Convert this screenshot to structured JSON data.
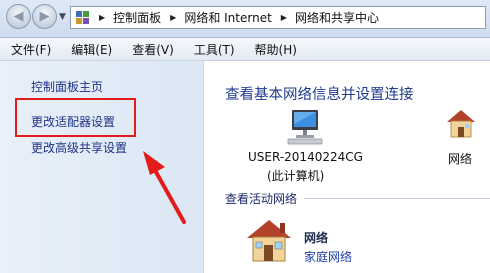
{
  "address_bar": {
    "crumbs": [
      "控制面板",
      "网络和 Internet",
      "网络和共享中心"
    ]
  },
  "menu": {
    "items": [
      "文件(F)",
      "编辑(E)",
      "查看(V)",
      "工具(T)",
      "帮助(H)"
    ]
  },
  "left_pane": {
    "home_link": "控制面板主页",
    "links": [
      "更改适配器设置",
      "更改高级共享设置"
    ]
  },
  "main": {
    "title": "查看基本网络信息并设置连接",
    "computer_name": "USER-20140224CG",
    "computer_sub": "(此计算机)",
    "network_label": "网络",
    "active_section": "查看活动网络",
    "active_network_name": "网络",
    "active_network_type": "家庭网络"
  },
  "colors": {
    "highlight": "#e41b1b",
    "link": "#1e3287",
    "title": "#1e3a8e"
  },
  "icons": [
    "back-arrow-icon",
    "forward-arrow-icon",
    "control-panel-icon",
    "computer-icon",
    "house-icon"
  ]
}
